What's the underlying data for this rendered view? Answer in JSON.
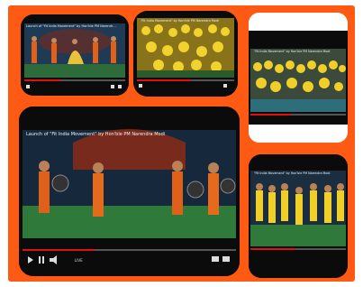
{
  "collage": {
    "frame_color": "#ff5a14",
    "tiles": [
      {
        "caption": "Launch of \"Fit India Movement\" by Hon'ble PM Narendra Modi"
      },
      {
        "caption": "\"Fit India Movement\" by Hon'ble PM Narendra Modi"
      },
      {
        "caption": "\"Fit India Movement\" by Hon'ble PM Narendra Modi"
      },
      {
        "caption": "Launch of \"Fit India Movement\" by Hon'ble PM Narendra Modi",
        "live_label": "LIVE"
      },
      {
        "caption": "\"Fit India Movement\" by Hon'ble PM Narendra Modi"
      }
    ]
  }
}
